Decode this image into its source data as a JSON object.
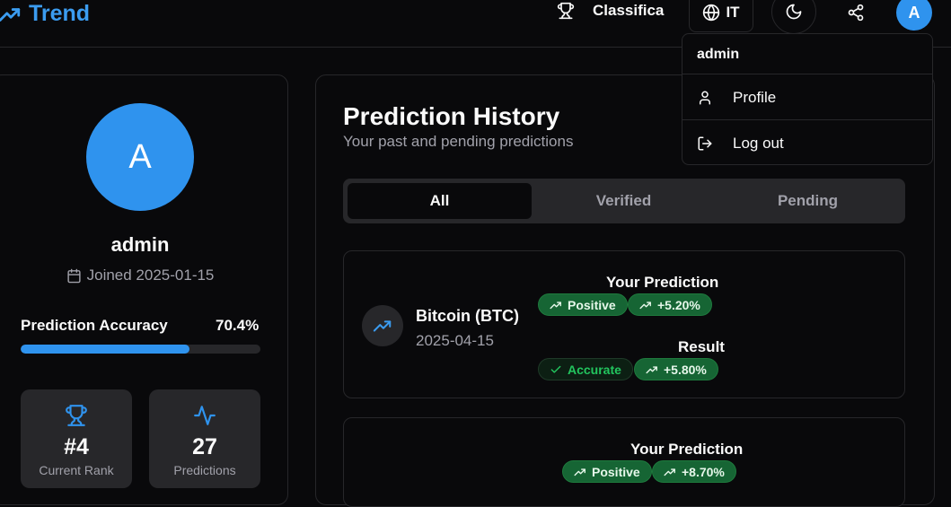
{
  "header": {
    "brand": "Trend",
    "leaderboard_label": "Classifica",
    "language_label": "IT",
    "avatar_initial": "A"
  },
  "user_menu": {
    "username": "admin",
    "items": [
      {
        "label": "Profile",
        "icon": "user-icon"
      },
      {
        "label": "Log out",
        "icon": "logout-icon"
      }
    ]
  },
  "profile": {
    "avatar_initial": "A",
    "username": "admin",
    "joined": "Joined 2025-01-15",
    "accuracy_label": "Prediction Accuracy",
    "accuracy_value": "70.4%",
    "accuracy_fraction": 0.704,
    "stats": [
      {
        "value": "#4",
        "label": "Current Rank",
        "icon": "trophy-icon"
      },
      {
        "value": "27",
        "label": "Predictions",
        "icon": "activity-icon"
      }
    ]
  },
  "history": {
    "title": "Prediction History",
    "subtitle": "Your past and pending predictions",
    "tabs": [
      "All",
      "Verified",
      "Pending"
    ],
    "active_tab": "All",
    "items": [
      {
        "coin": "Bitcoin (BTC)",
        "date": "2025-04-15",
        "your_prediction_label": "Your Prediction",
        "prediction_direction": "Positive",
        "prediction_change": "+5.20%",
        "result_label": "Result",
        "result_status": "Accurate",
        "result_change": "+5.80%"
      },
      {
        "your_prediction_label": "Your Prediction",
        "prediction_direction": "Positive",
        "prediction_change": "+8.70%"
      }
    ]
  },
  "colors": {
    "accent": "#2f93ee",
    "background": "#09090b",
    "surface": "#27272a",
    "positive": "#166534",
    "positive_text": "#22c55e"
  }
}
